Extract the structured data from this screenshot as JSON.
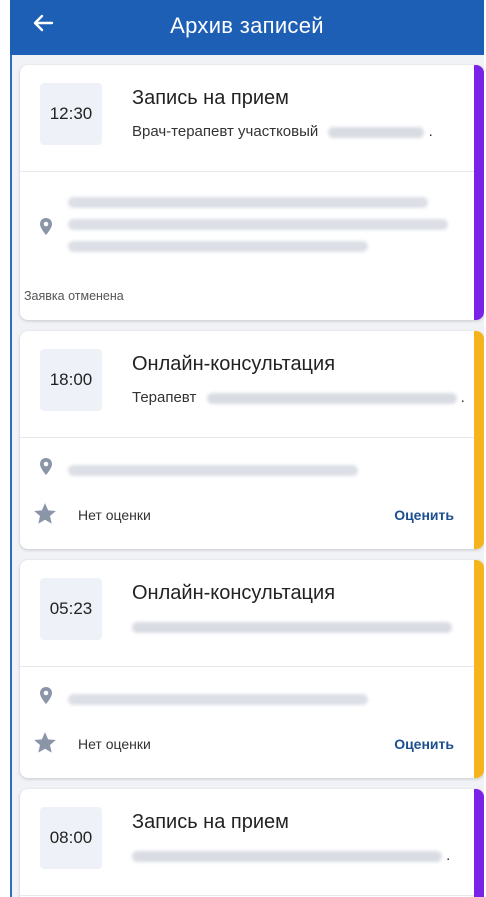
{
  "appbar": {
    "title": "Архив записей",
    "back_icon": "arrow-left-icon"
  },
  "colors": {
    "appbar": "#1c5fb5",
    "accent_purple": "#7b22e8",
    "accent_yellow": "#f5b41b",
    "rate_link": "#1b4f8f"
  },
  "records": [
    {
      "time": "12:30",
      "title": "Запись на прием",
      "subtitle": "Врач-терапевт участковый",
      "status": "Заявка отменена",
      "accent": "purple"
    },
    {
      "time": "18:00",
      "title": "Онлайн-консультация",
      "subtitle": "Терапевт",
      "rating": "Нет оценки",
      "rate_action": "Оценить",
      "accent": "yellow"
    },
    {
      "time": "05:23",
      "title": "Онлайн-консультация",
      "rating": "Нет оценки",
      "rate_action": "Оценить",
      "accent": "yellow"
    },
    {
      "time": "08:00",
      "title": "Запись на прием",
      "accent": "purple"
    }
  ]
}
